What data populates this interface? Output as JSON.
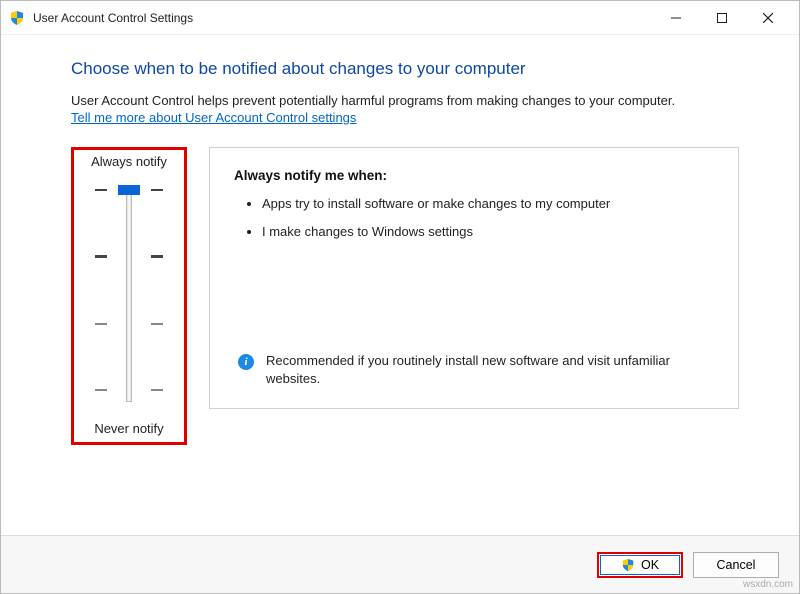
{
  "titlebar": {
    "title": "User Account Control Settings"
  },
  "heading": "Choose when to be notified about changes to your computer",
  "subtext": "User Account Control helps prevent potentially harmful programs from making changes to your computer.",
  "link": "Tell me more about User Account Control settings",
  "slider": {
    "top_label": "Always notify",
    "bottom_label": "Never notify",
    "level": 4,
    "max": 4
  },
  "info": {
    "title": "Always notify me when:",
    "bullets": [
      "Apps try to install software or make changes to my computer",
      "I make changes to Windows settings"
    ],
    "recommend": "Recommended if you routinely install new software and visit unfamiliar websites."
  },
  "buttons": {
    "ok": "OK",
    "cancel": "Cancel"
  },
  "watermark": "wsxdn.com"
}
